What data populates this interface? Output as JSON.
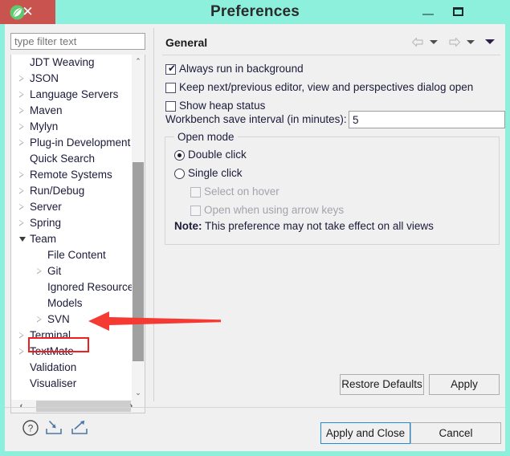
{
  "window": {
    "title": "Preferences",
    "app_icon": "spring-leaf-icon",
    "controls": {
      "minimize": "minimize-icon",
      "maximize": "maximize-icon",
      "close": "✕",
      "close_color": "#c9544f"
    },
    "frame_color": "#8cf0dc"
  },
  "sidebar": {
    "filter": {
      "value": "",
      "placeholder": "type filter text"
    },
    "tree": [
      {
        "label": "JDT Weaving",
        "indent": 1,
        "twisty": "none"
      },
      {
        "label": "JSON",
        "indent": 1,
        "twisty": "collapsed"
      },
      {
        "label": "Language Servers",
        "indent": 1,
        "twisty": "collapsed"
      },
      {
        "label": "Maven",
        "indent": 1,
        "twisty": "collapsed"
      },
      {
        "label": "Mylyn",
        "indent": 1,
        "twisty": "collapsed"
      },
      {
        "label": "Plug-in Development",
        "indent": 1,
        "twisty": "collapsed"
      },
      {
        "label": "Quick Search",
        "indent": 1,
        "twisty": "none"
      },
      {
        "label": "Remote Systems",
        "indent": 1,
        "twisty": "collapsed"
      },
      {
        "label": "Run/Debug",
        "indent": 1,
        "twisty": "collapsed"
      },
      {
        "label": "Server",
        "indent": 1,
        "twisty": "collapsed"
      },
      {
        "label": "Spring",
        "indent": 1,
        "twisty": "collapsed"
      },
      {
        "label": "Team",
        "indent": 1,
        "twisty": "expanded"
      },
      {
        "label": "File Content",
        "indent": 2,
        "twisty": "none"
      },
      {
        "label": "Git",
        "indent": 2,
        "twisty": "collapsed"
      },
      {
        "label": "Ignored Resources",
        "indent": 2,
        "twisty": "none"
      },
      {
        "label": "Models",
        "indent": 2,
        "twisty": "none"
      },
      {
        "label": "SVN",
        "indent": 2,
        "twisty": "collapsed",
        "highlighted": true
      },
      {
        "label": "Terminal",
        "indent": 1,
        "twisty": "collapsed"
      },
      {
        "label": "TextMate",
        "indent": 1,
        "twisty": "collapsed"
      },
      {
        "label": "Validation",
        "indent": 1,
        "twisty": "none"
      },
      {
        "label": "Visualiser",
        "indent": 1,
        "twisty": "none"
      }
    ],
    "scrollbar": {
      "up_arrow": "⌃",
      "down_arrow": "⌄",
      "left_arrow": "‹",
      "right_arrow": "›"
    }
  },
  "annotation": {
    "highlight_color": "#ef1f1f",
    "arrow_color": "#f53a33",
    "target": "SVN"
  },
  "main": {
    "title": "General",
    "nav": {
      "back_icon": "back-arrow-icon",
      "back_menu_icon": "chevron-down-icon",
      "forward_icon": "forward-arrow-icon",
      "forward_menu_icon": "chevron-down-icon",
      "more_menu_icon": "chevron-down-filled-icon"
    },
    "checkboxes": [
      {
        "label": "Always run in background",
        "checked": true,
        "enabled": true,
        "tick": "✔"
      },
      {
        "label": "Keep next/previous editor, view and perspectives dialog open",
        "checked": false,
        "enabled": true
      },
      {
        "label": "Show heap status",
        "checked": false,
        "enabled": true
      }
    ],
    "save_interval": {
      "label": "Workbench save interval (in minutes):",
      "value": "5"
    },
    "open_mode": {
      "legend": "Open mode",
      "radios": [
        {
          "label": "Double click",
          "selected": true
        },
        {
          "label": "Single click",
          "selected": false
        }
      ],
      "sub_checkboxes": [
        {
          "label": "Select on hover",
          "checked": false,
          "enabled": false
        },
        {
          "label": "Open when using arrow keys",
          "checked": false,
          "enabled": false
        }
      ],
      "note_prefix": "Note:",
      "note_text": "This preference may not take effect on all views"
    },
    "buttons": {
      "restore_defaults": "Restore Defaults",
      "apply": "Apply"
    }
  },
  "footer": {
    "icons": {
      "help": "help-icon",
      "import": "import-icon",
      "export": "export-icon"
    },
    "apply_and_close": "Apply and Close",
    "cancel": "Cancel"
  }
}
